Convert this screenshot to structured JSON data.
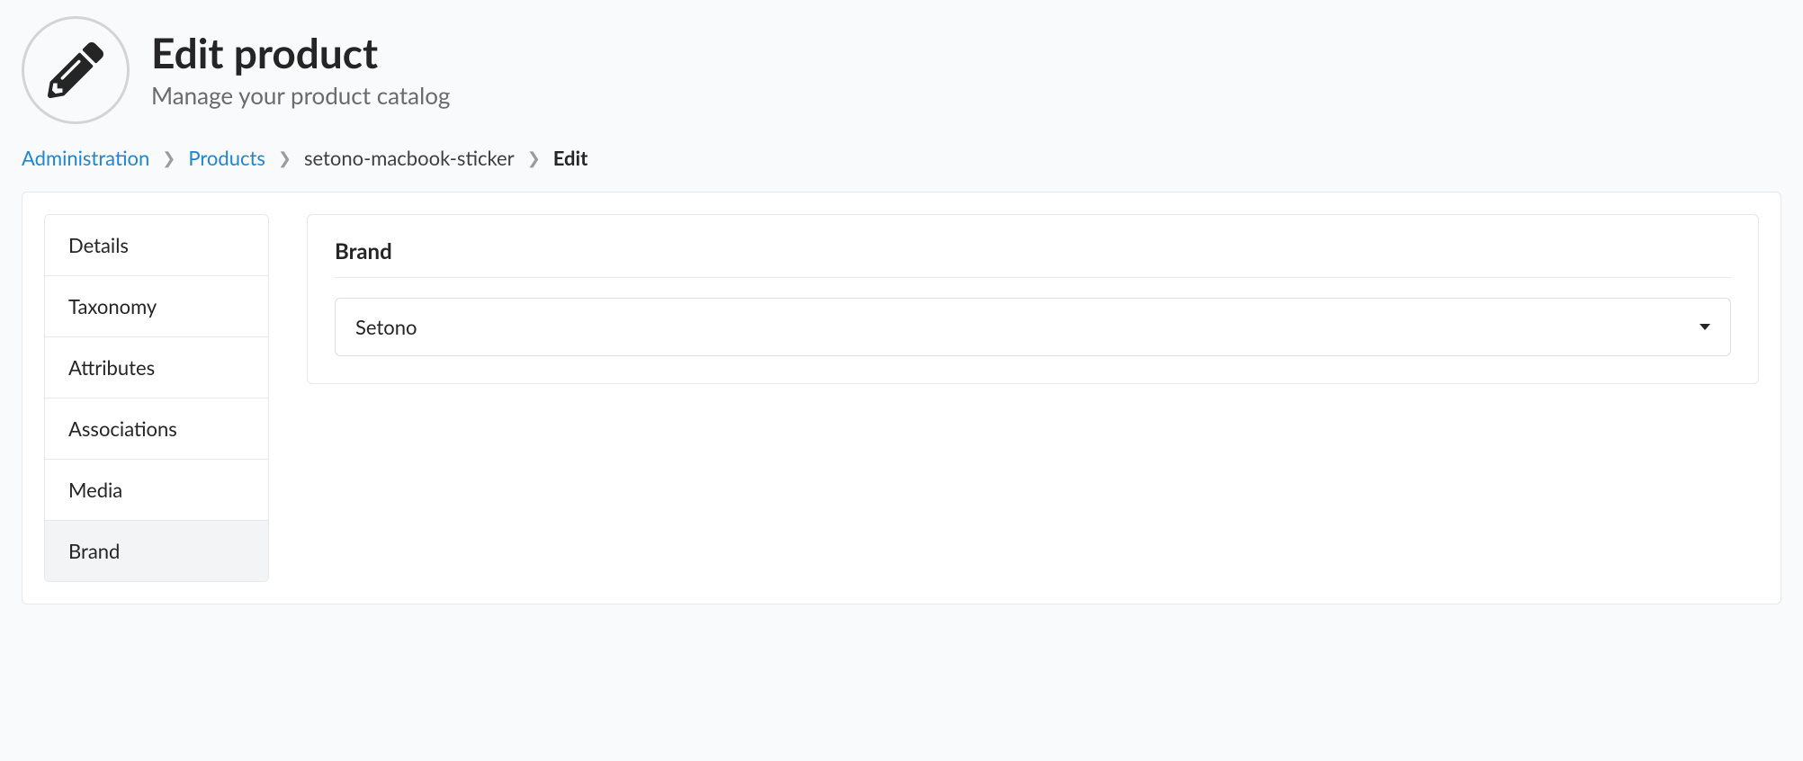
{
  "header": {
    "title": "Edit product",
    "subtitle": "Manage your product catalog"
  },
  "breadcrumb": {
    "items": [
      {
        "label": "Administration",
        "link": true
      },
      {
        "label": "Products",
        "link": true
      },
      {
        "label": "setono-macbook-sticker",
        "link": false
      },
      {
        "label": "Edit",
        "current": true
      }
    ]
  },
  "tabs": [
    {
      "label": "Details",
      "active": false
    },
    {
      "label": "Taxonomy",
      "active": false
    },
    {
      "label": "Attributes",
      "active": false
    },
    {
      "label": "Associations",
      "active": false
    },
    {
      "label": "Media",
      "active": false
    },
    {
      "label": "Brand",
      "active": true
    }
  ],
  "panel": {
    "title": "Brand",
    "brand_select": {
      "value": "Setono"
    }
  }
}
